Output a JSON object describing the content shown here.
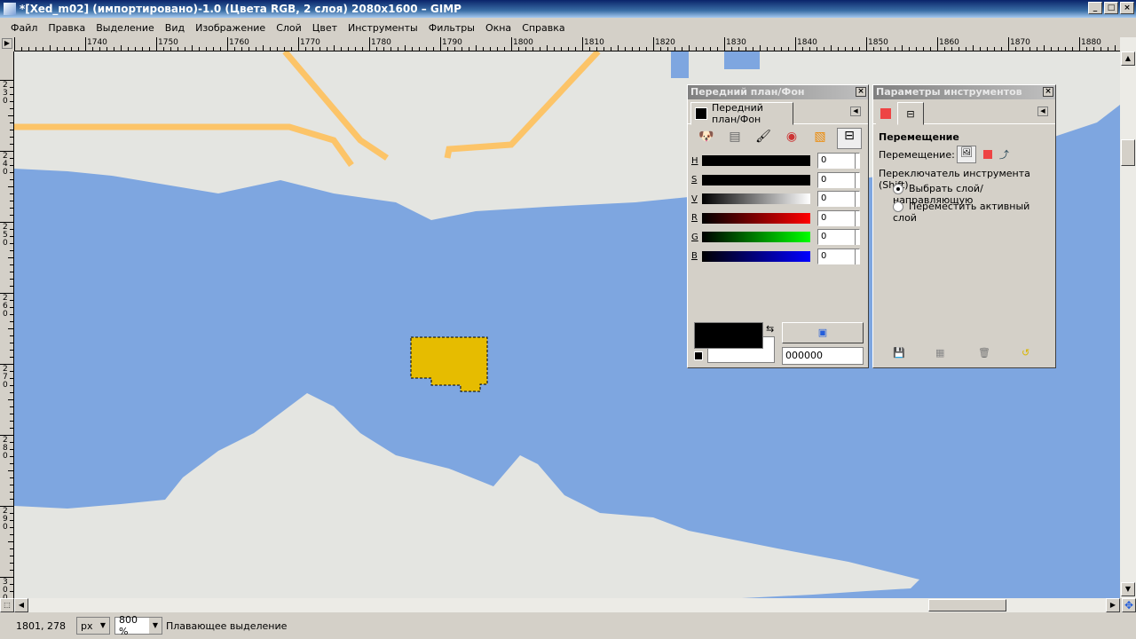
{
  "window": {
    "title": "*[Xed_m02] (импортировано)-1.0 (Цвета RGB, 2 слоя) 2080x1600 – GIMP",
    "buttons": [
      "_",
      "□",
      "×"
    ]
  },
  "menu": [
    "Файл",
    "Правка",
    "Выделение",
    "Вид",
    "Изображение",
    "Слой",
    "Цвет",
    "Инструменты",
    "Фильтры",
    "Окна",
    "Справка"
  ],
  "rulers": {
    "horizontal": [
      "1740",
      "1750",
      "1760",
      "1770",
      "1780",
      "1790",
      "1800",
      "1810",
      "1820",
      "1830",
      "1840",
      "1850",
      "1860",
      "1870",
      "1880"
    ],
    "vertical": [
      "230",
      "240",
      "250",
      "260",
      "270",
      "280",
      "290",
      "300"
    ]
  },
  "fgbg": {
    "title": "Передний план/Фон",
    "tab_label": "Передний план/Фон",
    "channels": [
      {
        "key": "H",
        "value": "0"
      },
      {
        "key": "S",
        "value": "0"
      },
      {
        "key": "V",
        "value": "0"
      },
      {
        "key": "R",
        "value": "0"
      },
      {
        "key": "G",
        "value": "0"
      },
      {
        "key": "B",
        "value": "0"
      }
    ],
    "hex": "000000",
    "fg_color": "#000000",
    "bg_color": "#ffffff"
  },
  "tool_options": {
    "title": "Параметры инструментов",
    "section": "Перемещение",
    "move_label": "Перемещение:",
    "switch_label": "Переключатель инструмента  (Shift)",
    "options": [
      {
        "label": "Выбрать слой/направляющую",
        "selected": true
      },
      {
        "label": "Переместить активный слой",
        "selected": false
      }
    ]
  },
  "status": {
    "coords": "1801, 278",
    "unit": "px",
    "zoom": "800 %",
    "message": "Плавающее выделение"
  },
  "colors": {
    "water": "#7ea6e0",
    "land": "#e4e5e1",
    "road": "#fcc468",
    "selection": "#e6bc00"
  }
}
